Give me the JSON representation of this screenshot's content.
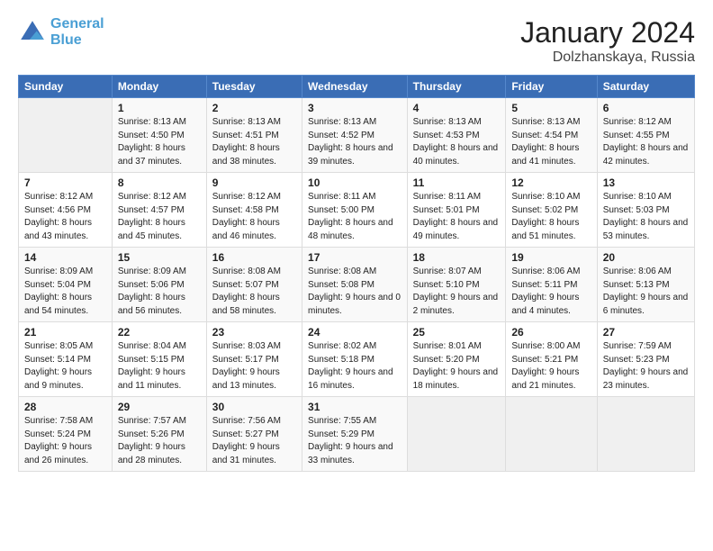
{
  "header": {
    "logo_line1": "General",
    "logo_line2": "Blue",
    "title": "January 2024",
    "subtitle": "Dolzhanskaya, Russia"
  },
  "weekdays": [
    "Sunday",
    "Monday",
    "Tuesday",
    "Wednesday",
    "Thursday",
    "Friday",
    "Saturday"
  ],
  "weeks": [
    [
      {
        "day": "",
        "sunrise": "",
        "sunset": "",
        "daylight": ""
      },
      {
        "day": "1",
        "sunrise": "Sunrise: 8:13 AM",
        "sunset": "Sunset: 4:50 PM",
        "daylight": "Daylight: 8 hours and 37 minutes."
      },
      {
        "day": "2",
        "sunrise": "Sunrise: 8:13 AM",
        "sunset": "Sunset: 4:51 PM",
        "daylight": "Daylight: 8 hours and 38 minutes."
      },
      {
        "day": "3",
        "sunrise": "Sunrise: 8:13 AM",
        "sunset": "Sunset: 4:52 PM",
        "daylight": "Daylight: 8 hours and 39 minutes."
      },
      {
        "day": "4",
        "sunrise": "Sunrise: 8:13 AM",
        "sunset": "Sunset: 4:53 PM",
        "daylight": "Daylight: 8 hours and 40 minutes."
      },
      {
        "day": "5",
        "sunrise": "Sunrise: 8:13 AM",
        "sunset": "Sunset: 4:54 PM",
        "daylight": "Daylight: 8 hours and 41 minutes."
      },
      {
        "day": "6",
        "sunrise": "Sunrise: 8:12 AM",
        "sunset": "Sunset: 4:55 PM",
        "daylight": "Daylight: 8 hours and 42 minutes."
      }
    ],
    [
      {
        "day": "7",
        "sunrise": "Sunrise: 8:12 AM",
        "sunset": "Sunset: 4:56 PM",
        "daylight": "Daylight: 8 hours and 43 minutes."
      },
      {
        "day": "8",
        "sunrise": "Sunrise: 8:12 AM",
        "sunset": "Sunset: 4:57 PM",
        "daylight": "Daylight: 8 hours and 45 minutes."
      },
      {
        "day": "9",
        "sunrise": "Sunrise: 8:12 AM",
        "sunset": "Sunset: 4:58 PM",
        "daylight": "Daylight: 8 hours and 46 minutes."
      },
      {
        "day": "10",
        "sunrise": "Sunrise: 8:11 AM",
        "sunset": "Sunset: 5:00 PM",
        "daylight": "Daylight: 8 hours and 48 minutes."
      },
      {
        "day": "11",
        "sunrise": "Sunrise: 8:11 AM",
        "sunset": "Sunset: 5:01 PM",
        "daylight": "Daylight: 8 hours and 49 minutes."
      },
      {
        "day": "12",
        "sunrise": "Sunrise: 8:10 AM",
        "sunset": "Sunset: 5:02 PM",
        "daylight": "Daylight: 8 hours and 51 minutes."
      },
      {
        "day": "13",
        "sunrise": "Sunrise: 8:10 AM",
        "sunset": "Sunset: 5:03 PM",
        "daylight": "Daylight: 8 hours and 53 minutes."
      }
    ],
    [
      {
        "day": "14",
        "sunrise": "Sunrise: 8:09 AM",
        "sunset": "Sunset: 5:04 PM",
        "daylight": "Daylight: 8 hours and 54 minutes."
      },
      {
        "day": "15",
        "sunrise": "Sunrise: 8:09 AM",
        "sunset": "Sunset: 5:06 PM",
        "daylight": "Daylight: 8 hours and 56 minutes."
      },
      {
        "day": "16",
        "sunrise": "Sunrise: 8:08 AM",
        "sunset": "Sunset: 5:07 PM",
        "daylight": "Daylight: 8 hours and 58 minutes."
      },
      {
        "day": "17",
        "sunrise": "Sunrise: 8:08 AM",
        "sunset": "Sunset: 5:08 PM",
        "daylight": "Daylight: 9 hours and 0 minutes."
      },
      {
        "day": "18",
        "sunrise": "Sunrise: 8:07 AM",
        "sunset": "Sunset: 5:10 PM",
        "daylight": "Daylight: 9 hours and 2 minutes."
      },
      {
        "day": "19",
        "sunrise": "Sunrise: 8:06 AM",
        "sunset": "Sunset: 5:11 PM",
        "daylight": "Daylight: 9 hours and 4 minutes."
      },
      {
        "day": "20",
        "sunrise": "Sunrise: 8:06 AM",
        "sunset": "Sunset: 5:13 PM",
        "daylight": "Daylight: 9 hours and 6 minutes."
      }
    ],
    [
      {
        "day": "21",
        "sunrise": "Sunrise: 8:05 AM",
        "sunset": "Sunset: 5:14 PM",
        "daylight": "Daylight: 9 hours and 9 minutes."
      },
      {
        "day": "22",
        "sunrise": "Sunrise: 8:04 AM",
        "sunset": "Sunset: 5:15 PM",
        "daylight": "Daylight: 9 hours and 11 minutes."
      },
      {
        "day": "23",
        "sunrise": "Sunrise: 8:03 AM",
        "sunset": "Sunset: 5:17 PM",
        "daylight": "Daylight: 9 hours and 13 minutes."
      },
      {
        "day": "24",
        "sunrise": "Sunrise: 8:02 AM",
        "sunset": "Sunset: 5:18 PM",
        "daylight": "Daylight: 9 hours and 16 minutes."
      },
      {
        "day": "25",
        "sunrise": "Sunrise: 8:01 AM",
        "sunset": "Sunset: 5:20 PM",
        "daylight": "Daylight: 9 hours and 18 minutes."
      },
      {
        "day": "26",
        "sunrise": "Sunrise: 8:00 AM",
        "sunset": "Sunset: 5:21 PM",
        "daylight": "Daylight: 9 hours and 21 minutes."
      },
      {
        "day": "27",
        "sunrise": "Sunrise: 7:59 AM",
        "sunset": "Sunset: 5:23 PM",
        "daylight": "Daylight: 9 hours and 23 minutes."
      }
    ],
    [
      {
        "day": "28",
        "sunrise": "Sunrise: 7:58 AM",
        "sunset": "Sunset: 5:24 PM",
        "daylight": "Daylight: 9 hours and 26 minutes."
      },
      {
        "day": "29",
        "sunrise": "Sunrise: 7:57 AM",
        "sunset": "Sunset: 5:26 PM",
        "daylight": "Daylight: 9 hours and 28 minutes."
      },
      {
        "day": "30",
        "sunrise": "Sunrise: 7:56 AM",
        "sunset": "Sunset: 5:27 PM",
        "daylight": "Daylight: 9 hours and 31 minutes."
      },
      {
        "day": "31",
        "sunrise": "Sunrise: 7:55 AM",
        "sunset": "Sunset: 5:29 PM",
        "daylight": "Daylight: 9 hours and 33 minutes."
      },
      {
        "day": "",
        "sunrise": "",
        "sunset": "",
        "daylight": ""
      },
      {
        "day": "",
        "sunrise": "",
        "sunset": "",
        "daylight": ""
      },
      {
        "day": "",
        "sunrise": "",
        "sunset": "",
        "daylight": ""
      }
    ]
  ]
}
